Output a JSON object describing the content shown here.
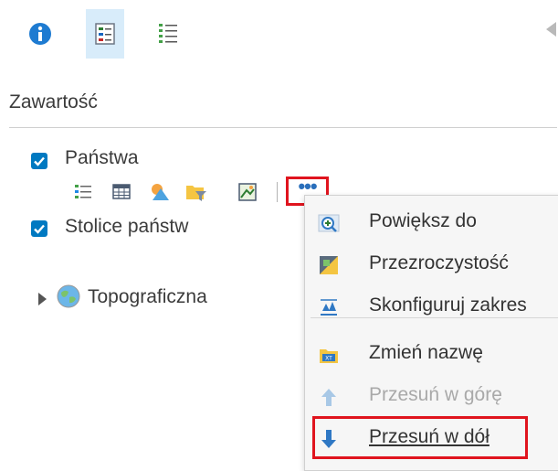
{
  "tabs": [
    {
      "icon": "info-icon",
      "active": false
    },
    {
      "icon": "legend-icon",
      "active": true
    },
    {
      "icon": "layer-list-icon",
      "active": false
    }
  ],
  "panel": {
    "title": "Zawartość"
  },
  "layers": [
    {
      "label": "Państwa",
      "checked": true
    },
    {
      "label": "Stolice państw",
      "checked": true
    },
    {
      "label": "Topograficzna",
      "type": "basemap"
    }
  ],
  "toolbar_icons": [
    "legend-icon",
    "table-icon",
    "symbology-icon",
    "filter-icon",
    "configure-popup-icon"
  ],
  "more_button": {
    "label": "•••"
  },
  "context_menu": {
    "items": [
      {
        "label": "Powiększ do",
        "icon": "zoom-to-icon",
        "enabled": true
      },
      {
        "label": "Przezroczystość",
        "icon": "transparency-icon",
        "enabled": true
      },
      {
        "label": "Skonfiguruj zakres",
        "icon": "configure-range-icon",
        "enabled": true
      },
      {
        "label": "Zmień nazwę",
        "icon": "rename-icon",
        "enabled": true
      },
      {
        "label": "Przesuń w górę",
        "icon": "arrow-up-icon",
        "enabled": false
      },
      {
        "label": "Przesuń w dół",
        "icon": "arrow-down-icon",
        "enabled": true,
        "highlighted": true
      }
    ]
  },
  "colors": {
    "accent": "#0079c1",
    "highlight": "#e0141e",
    "tab_active_bg": "#d8ecfa"
  }
}
